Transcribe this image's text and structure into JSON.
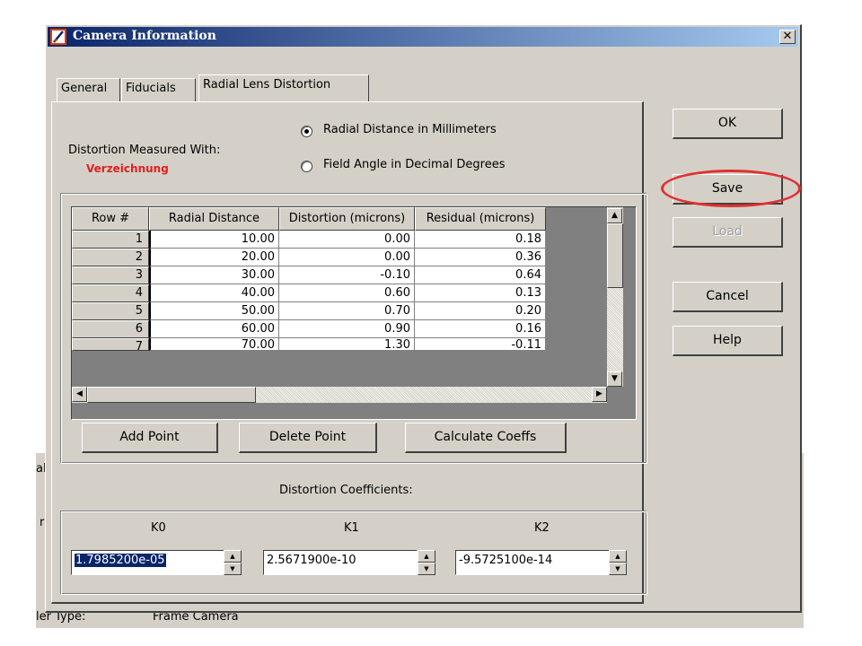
{
  "background_app": {
    "fragment_1": "al",
    "fragment_2": "r",
    "type_label": "ler Type:",
    "type_value": "Frame Camera"
  },
  "dialog": {
    "title": "Camera Information",
    "close_glyph": "✕"
  },
  "tabs": [
    {
      "label": "General",
      "active": false
    },
    {
      "label": "Fiducials",
      "active": false
    },
    {
      "label": "Radial Lens Distortion",
      "active": true
    }
  ],
  "distortion": {
    "measured_with_label": "Distortion Measured With:",
    "annotation": "Verzeichnung",
    "radio_millimeters": "Radial Distance in Millimeters",
    "radio_degrees": "Field Angle in Decimal Degrees",
    "selected": "millimeters"
  },
  "grid": {
    "columns": [
      "Row #",
      "Radial Distance",
      "Distortion (microns)",
      "Residual (microns)"
    ],
    "rows": [
      {
        "n": "1",
        "radial": "10.00",
        "distortion": "0.00",
        "residual": "0.18"
      },
      {
        "n": "2",
        "radial": "20.00",
        "distortion": "0.00",
        "residual": "0.36"
      },
      {
        "n": "3",
        "radial": "30.00",
        "distortion": "-0.10",
        "residual": "0.64"
      },
      {
        "n": "4",
        "radial": "40.00",
        "distortion": "0.60",
        "residual": "0.13"
      },
      {
        "n": "5",
        "radial": "50.00",
        "distortion": "0.70",
        "residual": "0.20"
      },
      {
        "n": "6",
        "radial": "60.00",
        "distortion": "0.90",
        "residual": "0.16"
      },
      {
        "n": "7",
        "radial": "70.00",
        "distortion": "1.30",
        "residual": "-0.11"
      }
    ],
    "scroll_up": "▲",
    "scroll_down": "▼",
    "scroll_left": "◀",
    "scroll_right": "▶"
  },
  "actions": {
    "add_point": "Add Point",
    "delete_point": "Delete Point",
    "calculate_coeffs": "Calculate Coeffs"
  },
  "coefficients": {
    "label": "Distortion Coefficients:",
    "k0": {
      "label": "K0",
      "value": "1.7985200e-05"
    },
    "k1": {
      "label": "K1",
      "value": "2.5671900e-10"
    },
    "k2": {
      "label": "K2",
      "value": "-9.5725100e-14"
    },
    "spin_up": "▲",
    "spin_down": "▼"
  },
  "side_buttons": {
    "ok": "OK",
    "save": "Save",
    "load": "Load",
    "cancel": "Cancel",
    "help": "Help"
  },
  "colors": {
    "title_start": "#0a246a",
    "title_end": "#a6caf0",
    "face": "#d4d0c8",
    "annotation_red": "#e02020"
  }
}
